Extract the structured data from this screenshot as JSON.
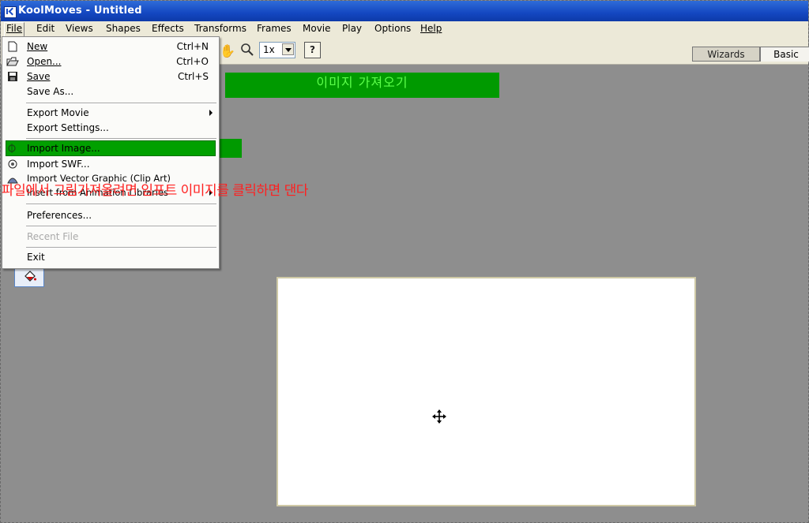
{
  "window": {
    "title": "KoolMoves - Untitled"
  },
  "menubar": {
    "items": [
      "File",
      "Edit",
      "Views",
      "Shapes",
      "Effects",
      "Transforms",
      "Frames",
      "Movie",
      "Play",
      "Options",
      "Help"
    ]
  },
  "toolbar": {
    "zoom_value": "1x",
    "help_label": "?"
  },
  "tabs": {
    "wizards": "Wizards",
    "basic": "Basic"
  },
  "banner": {
    "text": "이미지 가져오기"
  },
  "annotation": {
    "text": "파일에서 그림가져올려면 임포트 이미지를 클릭하면 댄다"
  },
  "file_menu": {
    "new": {
      "label": "New",
      "shortcut": "Ctrl+N"
    },
    "open": {
      "label": "Open...",
      "shortcut": "Ctrl+O"
    },
    "save": {
      "label": "Save",
      "shortcut": "Ctrl+S"
    },
    "save_as": {
      "label": "Save As..."
    },
    "export_movie": {
      "label": "Export Movie"
    },
    "export_settings": {
      "label": "Export Settings..."
    },
    "import_image": {
      "label": "Import Image..."
    },
    "import_swf": {
      "label": "Import SWF..."
    },
    "import_vector": {
      "label": "Import Vector Graphic (Clip Art)"
    },
    "insert_animation": {
      "label": "Insert from Animation Libraries"
    },
    "preferences": {
      "label": "Preferences..."
    },
    "recent_file": {
      "label": "Recent File"
    },
    "exit": {
      "label": "Exit"
    }
  },
  "icons": {
    "new": "new-file-icon",
    "open": "open-folder-icon",
    "save": "floppy-disk-icon",
    "import_image": "import-image-icon",
    "import_swf": "import-swf-icon",
    "import_vector": "clip-art-icon",
    "hand": "hand-tool-icon",
    "zoom": "magnifier-icon",
    "move": "move-cursor-icon",
    "paint": "paint-bucket-icon"
  },
  "colors": {
    "titlebar": "#1447c1",
    "highlight": "#00a000",
    "banner_bg": "#009a00",
    "banner_text": "#5cff4a",
    "annotation": "#ff2020",
    "workspace": "#8e8e8e"
  }
}
